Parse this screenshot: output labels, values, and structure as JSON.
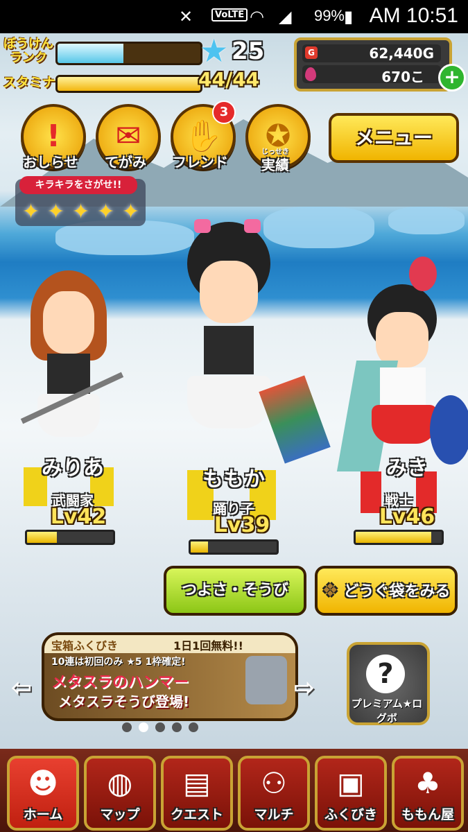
{
  "status_bar": {
    "battery_pct": "99%",
    "time": "AM 10:51",
    "volte": "VoLTE",
    "icons": [
      "mute-icon",
      "wifi-icon",
      "signal-icon",
      "battery-charging-icon"
    ]
  },
  "hud": {
    "rank_label": "ぼうけんランク",
    "rank_progress": 0.46,
    "rank_value": "25",
    "stamina_label": "スタミナ",
    "stamina_value": "44/44",
    "stamina_progress": 1.0,
    "gold": "62,440G",
    "gems": "670こ"
  },
  "menu_buttons": [
    {
      "label": "おしらせ",
      "icon": "exclamation-icon"
    },
    {
      "label": "てがみ",
      "icon": "mailbox-icon"
    },
    {
      "label": "フレンド",
      "icon": "handshake-icon",
      "badge": "3"
    },
    {
      "label": "実績",
      "ruby": "じっせき",
      "icon": "medal-icon"
    }
  ],
  "menu_button": "メニュー",
  "event": {
    "title": "キラキラをさがせ!!",
    "stars": 5
  },
  "characters": [
    {
      "name": "みりあ",
      "job": "武闘家",
      "level": "Lv42",
      "xp": 0.35
    },
    {
      "name": "ももか",
      "job": "踊り子",
      "level": "Lv39",
      "xp": 0.2
    },
    {
      "name": "みき",
      "job": "戦士",
      "level": "Lv46",
      "xp": 0.88
    }
  ],
  "actions": {
    "equip": "つよさ・そうび",
    "bag": "どうぐ袋をみる"
  },
  "banner": {
    "line1": "宝箱ふくびき",
    "line1b": "1日1回無料!!",
    "line2": "10連は初回のみ ★5 1枠確定!",
    "line3": "メタスラのハンマー",
    "line4": "メタスラそうび登場!",
    "dots": 5,
    "active_dot": 1
  },
  "premium": {
    "label": "プレミアム★ログボ",
    "glyph": "?"
  },
  "nav": [
    {
      "label": "ホーム",
      "icon": "home-avatar-icon"
    },
    {
      "label": "マップ",
      "icon": "globe-icon"
    },
    {
      "label": "クエスト",
      "icon": "quest-book-icon"
    },
    {
      "label": "マルチ",
      "icon": "multiplayer-icon"
    },
    {
      "label": "ふくびき",
      "icon": "treasure-chest-icon"
    },
    {
      "label": "ももん屋",
      "icon": "momon-shop-icon"
    }
  ],
  "colors": {
    "gold": "#f0b400",
    "green_button": "#9bdc2a",
    "nav_red": "#b2261a"
  }
}
